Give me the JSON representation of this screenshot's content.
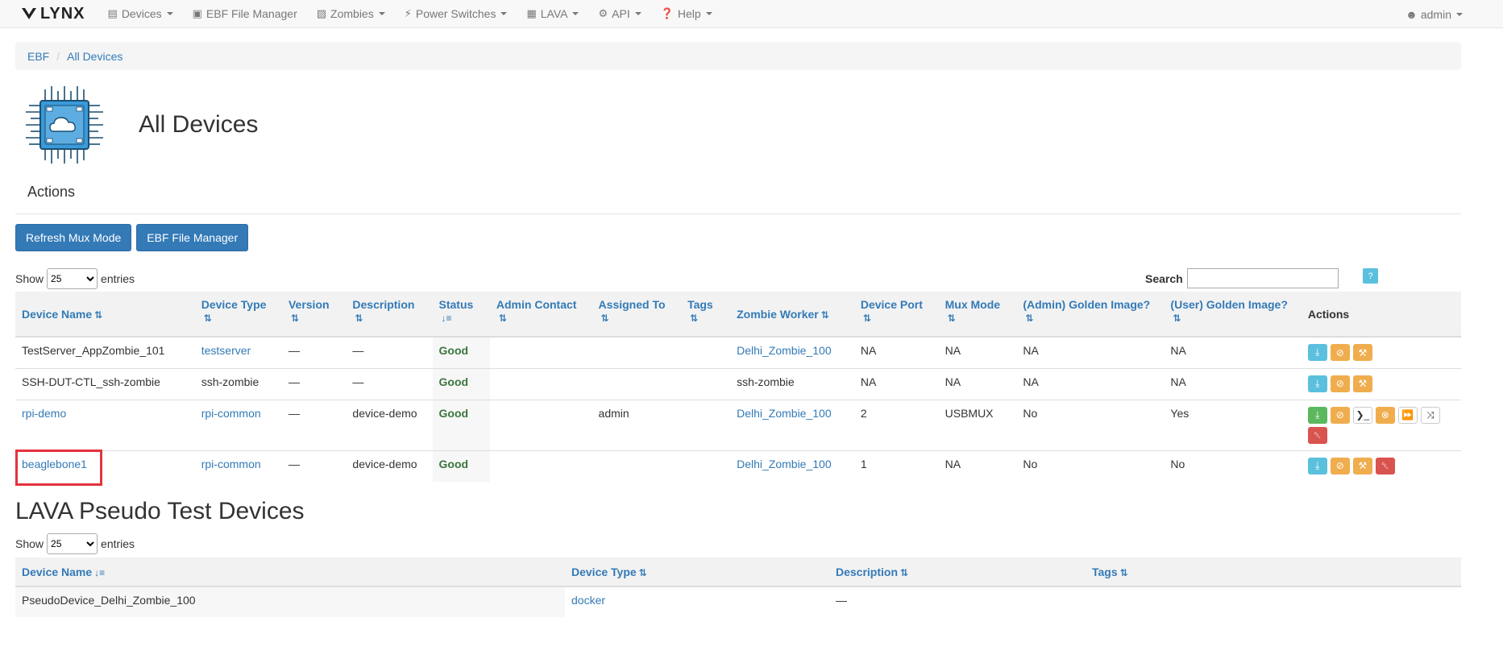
{
  "nav": {
    "brand": "LYNX",
    "items": [
      {
        "label": "Devices",
        "icon": "device-icon",
        "caret": true
      },
      {
        "label": "EBF File Manager",
        "icon": "folder-icon",
        "caret": false
      },
      {
        "label": "Zombies",
        "icon": "zombie-icon",
        "caret": true
      },
      {
        "label": "Power Switches",
        "icon": "bolt-icon",
        "caret": true
      },
      {
        "label": "LAVA",
        "icon": "calendar-icon",
        "caret": true
      },
      {
        "label": "API",
        "icon": "gear-icon",
        "caret": true
      },
      {
        "label": "Help",
        "icon": "question-icon",
        "caret": true
      }
    ],
    "user": "admin"
  },
  "breadcrumb": [
    "EBF",
    "All Devices"
  ],
  "page_title": "All Devices",
  "actions_title": "Actions",
  "buttons": {
    "refresh": "Refresh Mux Mode",
    "file_manager": "EBF File Manager"
  },
  "show": {
    "label1": "Show",
    "value": "25",
    "label2": "entries"
  },
  "search_label": "Search",
  "help_glyph": "?",
  "devices_table": {
    "columns": [
      "Device Name",
      "Device Type",
      "Version",
      "Description",
      "Status",
      "Admin Contact",
      "Assigned To",
      "Tags",
      "Zombie Worker",
      "Device Port",
      "Mux Mode",
      "(Admin) Golden Image?",
      "(User) Golden Image?",
      "Actions"
    ],
    "rows": [
      {
        "name": "TestServer_AppZombie_101",
        "name_link": false,
        "type": "testserver",
        "type_link": true,
        "version": "—",
        "description": "—",
        "status": "Good",
        "admin": "",
        "assigned": "",
        "tags": "",
        "worker": "Delhi_Zombie_100",
        "worker_link": true,
        "port": "NA",
        "mux": "NA",
        "admin_golden": "NA",
        "user_golden": "NA",
        "actions": [
          "info",
          "warn",
          "warn"
        ]
      },
      {
        "name": "SSH-DUT-CTL_ssh-zombie",
        "name_link": false,
        "type": "ssh-zombie",
        "type_link": false,
        "version": "—",
        "description": "—",
        "status": "Good",
        "admin": "",
        "assigned": "",
        "tags": "",
        "worker": "ssh-zombie",
        "worker_link": false,
        "port": "NA",
        "mux": "NA",
        "admin_golden": "NA",
        "user_golden": "NA",
        "actions": [
          "info",
          "warn",
          "warn"
        ]
      },
      {
        "name": "rpi-demo",
        "name_link": true,
        "type": "rpi-common",
        "type_link": true,
        "version": "—",
        "description": "device-demo",
        "status": "Good",
        "admin": "",
        "assigned": "admin",
        "tags": "",
        "worker": "Delhi_Zombie_100",
        "worker_link": true,
        "port": "2",
        "mux": "USBMUX",
        "admin_golden": "No",
        "user_golden": "Yes",
        "actions": [
          "success",
          "warn",
          "def",
          "warn",
          "def",
          "def",
          "danger"
        ]
      },
      {
        "name": "beaglebone1",
        "name_link": true,
        "type": "rpi-common",
        "type_link": true,
        "version": "—",
        "description": "device-demo",
        "status": "Good",
        "admin": "",
        "assigned": "",
        "tags": "",
        "worker": "Delhi_Zombie_100",
        "worker_link": true,
        "port": "1",
        "mux": "NA",
        "admin_golden": "No",
        "user_golden": "No",
        "actions": [
          "info",
          "warn",
          "warn",
          "danger"
        ]
      }
    ]
  },
  "lava_title": "LAVA Pseudo Test Devices",
  "lava_table": {
    "columns": [
      "Device Name",
      "Device Type",
      "Description",
      "Tags"
    ],
    "rows": [
      {
        "name": "PseudoDevice_Delhi_Zombie_100",
        "type": "docker",
        "description": "—",
        "tags": ""
      }
    ]
  }
}
